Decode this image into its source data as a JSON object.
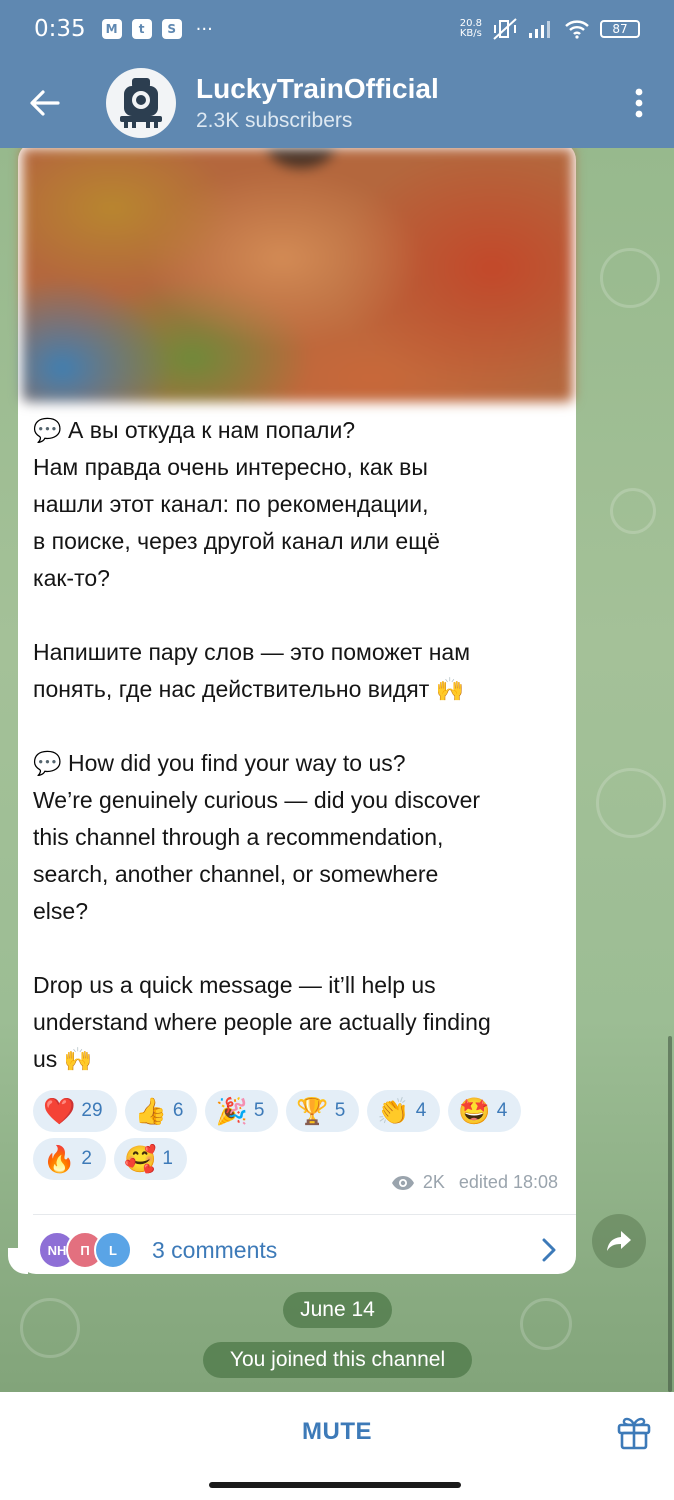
{
  "status_bar": {
    "time": "0:35",
    "apps": [
      "M",
      "t",
      "S"
    ],
    "more": "···",
    "net_speed": "20.8",
    "net_unit": "KB/s",
    "battery": "87"
  },
  "header": {
    "title": "LuckyTrainOfficial",
    "subtitle": "2.3K subscribers"
  },
  "message": {
    "paragraphs": [
      "А вы откуда к нам попали?\nНам правда очень интересно, как вы\nнашли этот канал: по рекомендации,\nв поиске, через другой канал или ещё\nкак-то?",
      "Напишите пару слов — это поможет нам\nпонять, где нас действительно видят",
      "How did you find your way to us?\nWe’re genuinely curious — did you discover\nthis channel through a recommendation,\nsearch, another channel, or somewhere\nelse?",
      "Drop us a quick message — it’ll help us\nunderstand where people are actually finding\nus"
    ],
    "emoji_speech": "💬",
    "emoji_hands": "🙌",
    "views": "2K",
    "edited": "edited 18:08"
  },
  "reactions": [
    {
      "emoji": "❤️",
      "count": "29"
    },
    {
      "emoji": "👍",
      "count": "6"
    },
    {
      "emoji": "🎉",
      "count": "5"
    },
    {
      "emoji": "🏆",
      "count": "5"
    },
    {
      "emoji": "👏",
      "count": "4"
    },
    {
      "emoji": "🤩",
      "count": "4"
    },
    {
      "emoji": "🔥",
      "count": "2"
    },
    {
      "emoji": "🥰",
      "count": "1"
    }
  ],
  "comments": {
    "avatars": [
      {
        "initials": "NH",
        "color": "#8e6fd6"
      },
      {
        "initials": "П",
        "color": "#e3707f"
      },
      {
        "initials": "L",
        "color": "#5aa4e6"
      }
    ],
    "label": "3 comments"
  },
  "service": {
    "date": "June 14",
    "joined": "You joined this channel"
  },
  "bottom": {
    "mute": "MUTE"
  },
  "colors": {
    "header_bg": "#5f88b1",
    "accent": "#3d7ab8",
    "reaction_bg": "#e4eef7",
    "service_pill": "#4e7848"
  }
}
